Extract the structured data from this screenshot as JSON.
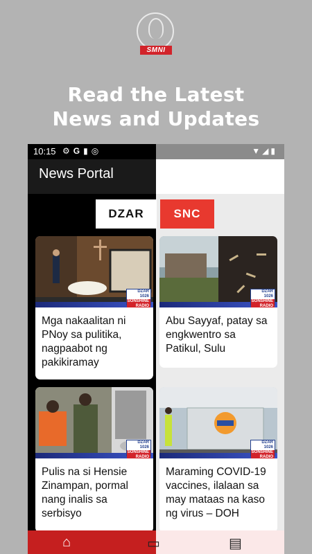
{
  "promo": {
    "logo_text": "SMNI",
    "headline_line1": "Read the Latest",
    "headline_line2": "News and Updates"
  },
  "status_bar": {
    "time": "10:15",
    "left_icons": [
      "gear-icon",
      "google-icon",
      "sdcard-icon",
      "sync-icon"
    ],
    "right_icons": [
      "wifi-icon",
      "signal-icon",
      "battery-icon"
    ]
  },
  "app_bar": {
    "title": "News Portal"
  },
  "tabs": [
    {
      "label": "DZAR"
    },
    {
      "label": "SNC"
    }
  ],
  "articles": [
    {
      "title": "Mga nakaalitan ni PNoy sa pulitika, nagpaabot ng pakikiramay"
    },
    {
      "title": "Abu Sayyaf, patay sa engkwentro sa Patikul, Sulu"
    },
    {
      "title": "Pulis na si Hensie Zinampan, pormal nang inalis sa serbisyo"
    },
    {
      "title": "Maraming COVID-19 vaccines, ilalaan sa may mataas na kaso ng virus – DOH"
    }
  ],
  "watermark": {
    "line1": "DZAR",
    "line2": "1026",
    "line3": "SONSHINE RADIO"
  },
  "bottom_nav": [
    {
      "icon": "home-icon"
    },
    {
      "icon": "tv-icon"
    },
    {
      "icon": "newspaper-icon"
    }
  ],
  "colors": {
    "accent_red": "#e8392f",
    "nav_red": "#c51f1f",
    "background": "#b3b3b3"
  }
}
